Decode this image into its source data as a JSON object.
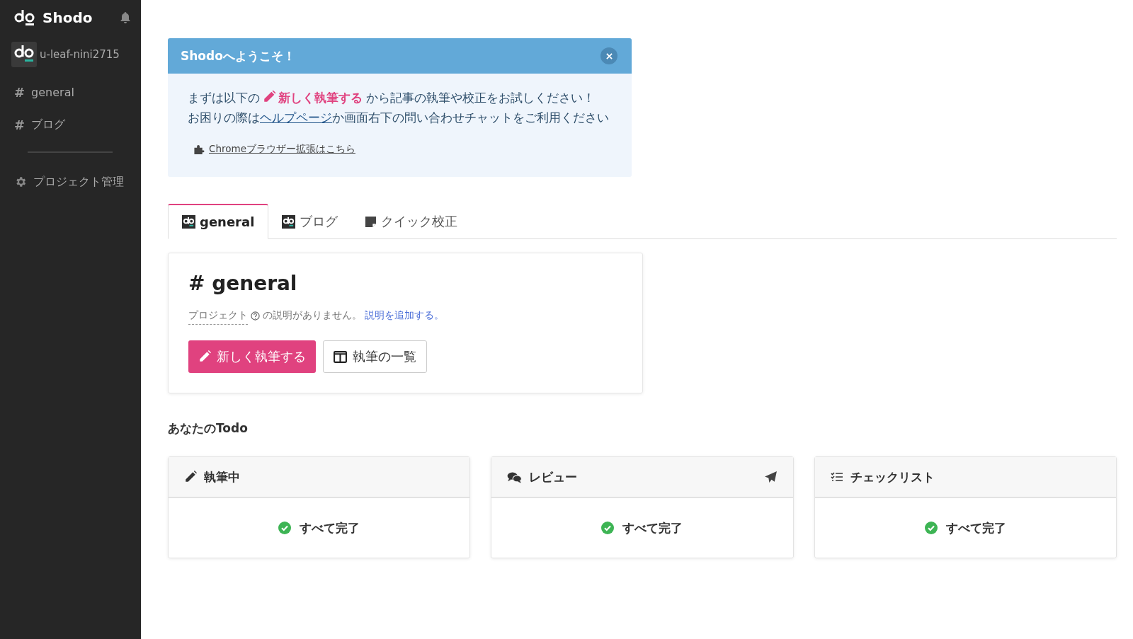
{
  "sidebar": {
    "app_name": "Shodo",
    "user": "u-leaf-nini2715",
    "channels": [
      {
        "icon": "#",
        "label": "general"
      },
      {
        "icon": "#",
        "label": "ブログ"
      }
    ],
    "settings": "プロジェクト管理"
  },
  "welcome": {
    "title": "Shodoへようこそ！",
    "intro_before": "まずは以下の",
    "intro_link": "新しく執筆する",
    "intro_after": "から記事の執筆や校正をお試しください！",
    "help_before": "お困りの際は",
    "help_link": "ヘルプページ",
    "help_after": "か画面右下の問い合わせチャットをご利用ください",
    "extension_link": "Chromeブラウザー拡張はこちら"
  },
  "tabs": [
    {
      "kind": "project",
      "label": "general",
      "selected": true
    },
    {
      "kind": "project",
      "label": "ブログ",
      "selected": false
    },
    {
      "kind": "quick",
      "label": "クイック校正",
      "selected": false
    }
  ],
  "project": {
    "title": "# general",
    "desc_term": "プロジェクト",
    "desc_text": "の説明がありません。",
    "desc_link": "説明を追加する。",
    "buttons": [
      {
        "kind": "primary",
        "label": "新しく執筆する"
      },
      {
        "kind": "secondary",
        "label": "執筆の一覧"
      }
    ]
  },
  "todo": {
    "heading": "あなたのTodo",
    "cards": [
      {
        "kind": "writing",
        "title": "執筆中",
        "send": false,
        "status": "すべて完了"
      },
      {
        "kind": "review",
        "title": "レビュー",
        "send": true,
        "status": "すべて完了"
      },
      {
        "kind": "checklist",
        "title": "チェックリスト",
        "send": false,
        "status": "すべて完了"
      }
    ]
  }
}
